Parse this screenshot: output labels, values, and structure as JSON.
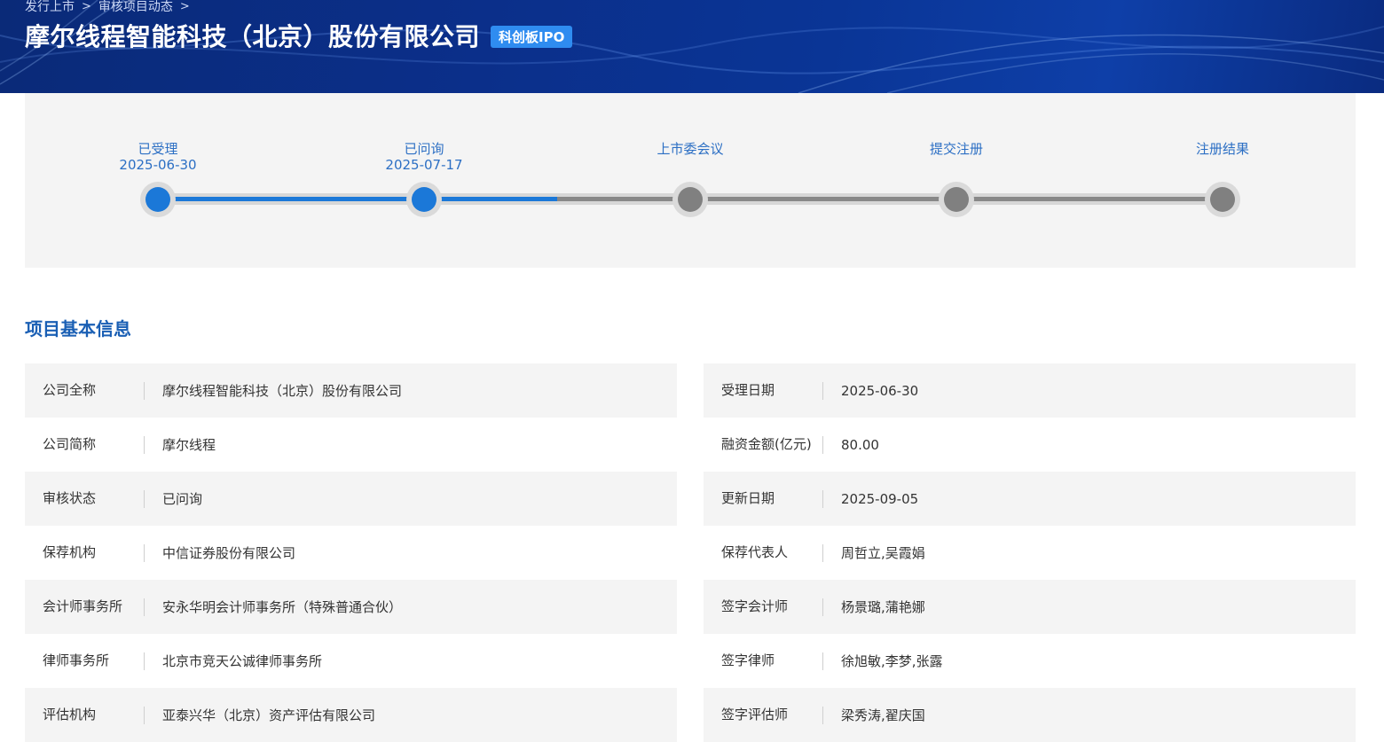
{
  "breadcrumb": [
    "发行上市",
    "审核项目动态"
  ],
  "header": {
    "title": "摩尔线程智能科技（北京）股份有限公司",
    "badge": "科创板IPO"
  },
  "progress": {
    "steps": [
      {
        "label": "已受理",
        "date": "2025-06-30",
        "done": true
      },
      {
        "label": "已问询",
        "date": "2025-07-17",
        "done": true
      },
      {
        "label": "上市委会议",
        "date": "",
        "done": false
      },
      {
        "label": "提交注册",
        "date": "",
        "done": false
      },
      {
        "label": "注册结果",
        "date": "",
        "done": false
      }
    ],
    "completed_fraction": 0.375
  },
  "section": {
    "title": "项目基本信息"
  },
  "info": {
    "left": [
      {
        "key": "公司全称",
        "value": "摩尔线程智能科技（北京）股份有限公司"
      },
      {
        "key": "公司简称",
        "value": "摩尔线程"
      },
      {
        "key": "审核状态",
        "value": "已问询"
      },
      {
        "key": "保荐机构",
        "value": "中信证券股份有限公司"
      },
      {
        "key": "会计师事务所",
        "value": "安永华明会计师事务所（特殊普通合伙）"
      },
      {
        "key": "律师事务所",
        "value": "北京市竞天公诚律师事务所"
      },
      {
        "key": "评估机构",
        "value": "亚泰兴华（北京）资产评估有限公司"
      }
    ],
    "right": [
      {
        "key": "受理日期",
        "value": "2025-06-30"
      },
      {
        "key": "融资金额(亿元)",
        "value": "80.00"
      },
      {
        "key": "更新日期",
        "value": "2025-09-05"
      },
      {
        "key": "保荐代表人",
        "value": "周哲立,吴霞娟"
      },
      {
        "key": "签字会计师",
        "value": "杨景璐,蒲艳娜"
      },
      {
        "key": "签字律师",
        "value": "徐旭敏,李梦,张露"
      },
      {
        "key": "签字评估师",
        "value": "梁秀涛,翟庆国"
      }
    ]
  },
  "colors": {
    "accent": "#1b78d8",
    "banner": "#0b2f8a",
    "badge": "#2f8cf0"
  }
}
